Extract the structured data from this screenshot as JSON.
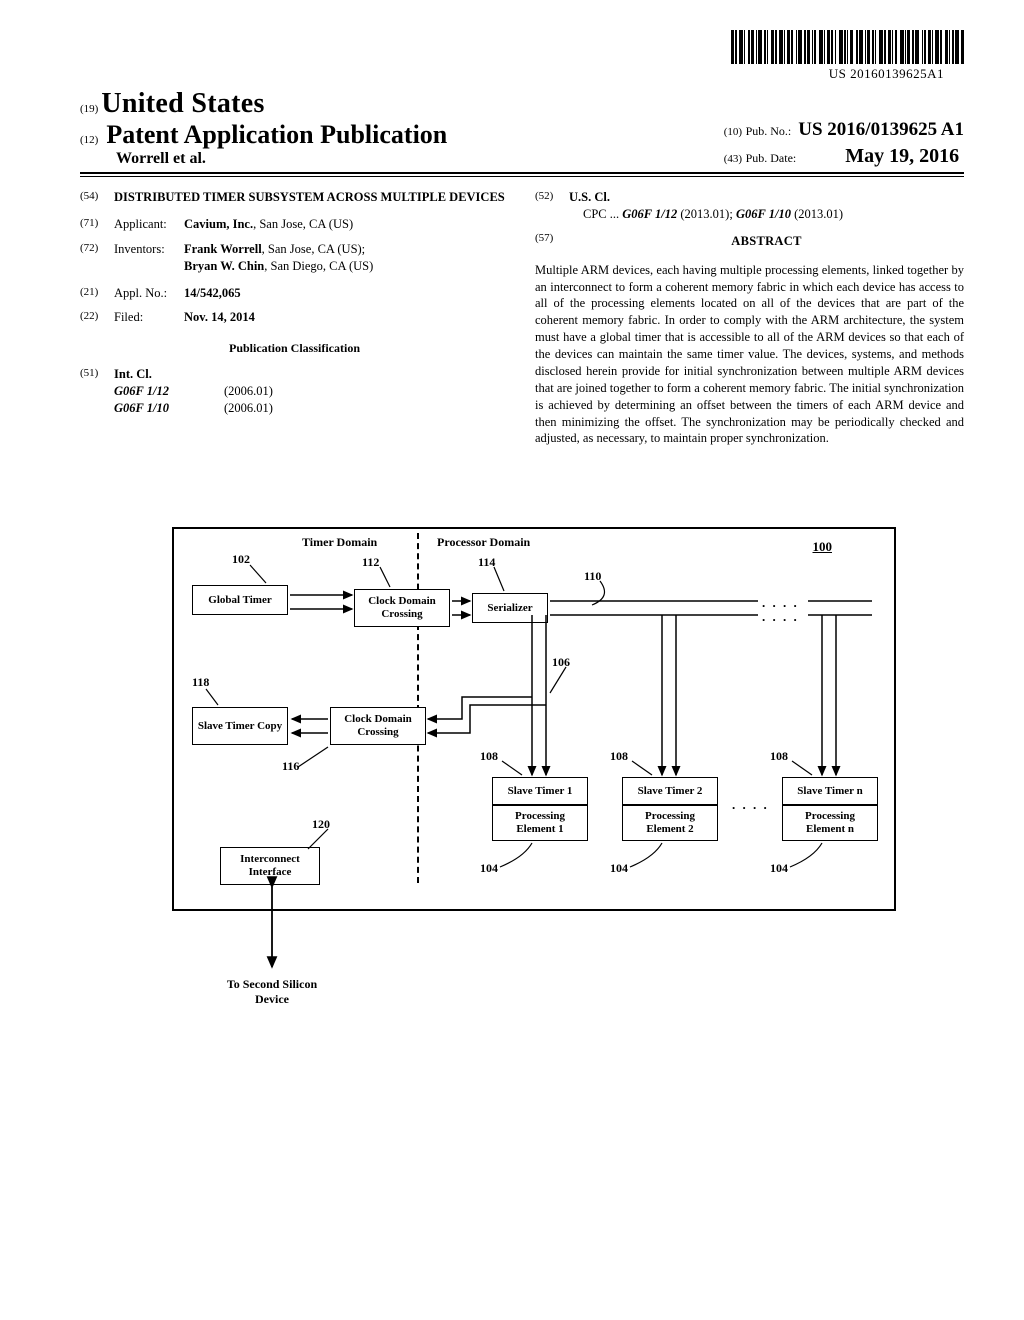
{
  "barcode_text": "US 20160139625A1",
  "header": {
    "code19": "(19)",
    "country": "United States",
    "code12": "(12)",
    "pub_type": "Patent Application Publication",
    "authors": "Worrell et al.",
    "code10": "(10)",
    "pubno_lbl": "Pub. No.:",
    "pubno": "US 2016/0139625 A1",
    "code43": "(43)",
    "pubdate_lbl": "Pub. Date:",
    "pubdate": "May 19, 2016"
  },
  "left": {
    "f54_num": "(54)",
    "f54_title": "DISTRIBUTED TIMER SUBSYSTEM ACROSS MULTIPLE DEVICES",
    "f71_num": "(71)",
    "f71_lbl": "Applicant:",
    "f71_body": "Cavium, Inc., San Jose, CA (US)",
    "f71_name": "Cavium, Inc.",
    "f72_num": "(72)",
    "f72_lbl": "Inventors:",
    "f72_name1": "Frank Worrell",
    "f72_loc1": ", San Jose, CA (US);",
    "f72_name2": "Bryan W. Chin",
    "f72_loc2": ", San Diego, CA (US)",
    "f21_num": "(21)",
    "f21_lbl": "Appl. No.:",
    "f21_val": "14/542,065",
    "f22_num": "(22)",
    "f22_lbl": "Filed:",
    "f22_val": "Nov. 14, 2014",
    "pubclass_hdr": "Publication Classification",
    "f51_num": "(51)",
    "f51_lbl": "Int. Cl.",
    "intcl1_code": "G06F 1/12",
    "intcl1_ver": "(2006.01)",
    "intcl2_code": "G06F 1/10",
    "intcl2_ver": "(2006.01)"
  },
  "right": {
    "f52_num": "(52)",
    "f52_lbl": "U.S. Cl.",
    "f52_cpc_lbl": "CPC ...",
    "f52_cpc1": "G06F 1/12",
    "f52_cpc1_ver": "(2013.01);",
    "f52_cpc2": "G06F 1/10",
    "f52_cpc2_ver": "(2013.01)",
    "f57_num": "(57)",
    "abs_hdr": "ABSTRACT",
    "abs_text": "Multiple ARM devices, each having multiple processing elements, linked together by an interconnect to form a coherent memory fabric in which each device has access to all of the processing elements located on all of the devices that are part of the coherent memory fabric. In order to comply with the ARM architecture, the system must have a global timer that is accessible to all of the ARM devices so that each of the devices can maintain the same timer value. The devices, systems, and methods disclosed herein provide for initial synchronization between multiple ARM devices that are joined together to form a coherent memory fabric. The initial synchronization is achieved by determining an offset between the timers of each ARM device and then minimizing the offset. The synchronization may be periodically checked and adjusted, as necessary, to maintain proper synchronization."
  },
  "figure": {
    "timer_domain": "Timer Domain",
    "processor_domain": "Processor Domain",
    "fig_ref": "100",
    "nodes": {
      "global_timer": "Global Timer",
      "cdc1": "Clock Domain Crossing",
      "serializer": "Serializer",
      "slave_timer_copy": "Slave Timer Copy",
      "cdc2": "Clock Domain Crossing",
      "interconnect": "Interconnect Interface",
      "st1": "Slave Timer 1",
      "pe1": "Processing Element 1",
      "st2": "Slave Timer 2",
      "pe2": "Processing Element 2",
      "stn": "Slave Timer n",
      "pen": "Processing Element n"
    },
    "refs": {
      "r102": "102",
      "r112": "112",
      "r114": "114",
      "r110": "110",
      "r118": "118",
      "r116": "116",
      "r120": "120",
      "r106": "106",
      "r108a": "108",
      "r108b": "108",
      "r108c": "108",
      "r104a": "104",
      "r104b": "104",
      "r104c": "104"
    },
    "to_second": "To Second Silicon Device"
  }
}
